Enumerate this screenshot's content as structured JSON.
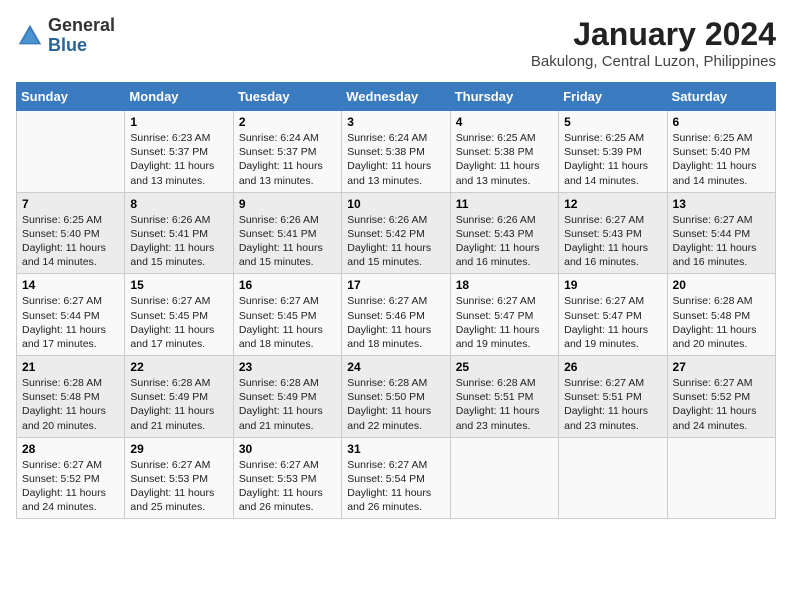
{
  "header": {
    "logo_general": "General",
    "logo_blue": "Blue",
    "month_year": "January 2024",
    "location": "Bakulong, Central Luzon, Philippines"
  },
  "weekdays": [
    "Sunday",
    "Monday",
    "Tuesday",
    "Wednesday",
    "Thursday",
    "Friday",
    "Saturday"
  ],
  "weeks": [
    [
      {
        "day": "",
        "content": ""
      },
      {
        "day": "1",
        "content": "Sunrise: 6:23 AM\nSunset: 5:37 PM\nDaylight: 11 hours\nand 13 minutes."
      },
      {
        "day": "2",
        "content": "Sunrise: 6:24 AM\nSunset: 5:37 PM\nDaylight: 11 hours\nand 13 minutes."
      },
      {
        "day": "3",
        "content": "Sunrise: 6:24 AM\nSunset: 5:38 PM\nDaylight: 11 hours\nand 13 minutes."
      },
      {
        "day": "4",
        "content": "Sunrise: 6:25 AM\nSunset: 5:38 PM\nDaylight: 11 hours\nand 13 minutes."
      },
      {
        "day": "5",
        "content": "Sunrise: 6:25 AM\nSunset: 5:39 PM\nDaylight: 11 hours\nand 14 minutes."
      },
      {
        "day": "6",
        "content": "Sunrise: 6:25 AM\nSunset: 5:40 PM\nDaylight: 11 hours\nand 14 minutes."
      }
    ],
    [
      {
        "day": "7",
        "content": "Sunrise: 6:25 AM\nSunset: 5:40 PM\nDaylight: 11 hours\nand 14 minutes."
      },
      {
        "day": "8",
        "content": "Sunrise: 6:26 AM\nSunset: 5:41 PM\nDaylight: 11 hours\nand 15 minutes."
      },
      {
        "day": "9",
        "content": "Sunrise: 6:26 AM\nSunset: 5:41 PM\nDaylight: 11 hours\nand 15 minutes."
      },
      {
        "day": "10",
        "content": "Sunrise: 6:26 AM\nSunset: 5:42 PM\nDaylight: 11 hours\nand 15 minutes."
      },
      {
        "day": "11",
        "content": "Sunrise: 6:26 AM\nSunset: 5:43 PM\nDaylight: 11 hours\nand 16 minutes."
      },
      {
        "day": "12",
        "content": "Sunrise: 6:27 AM\nSunset: 5:43 PM\nDaylight: 11 hours\nand 16 minutes."
      },
      {
        "day": "13",
        "content": "Sunrise: 6:27 AM\nSunset: 5:44 PM\nDaylight: 11 hours\nand 16 minutes."
      }
    ],
    [
      {
        "day": "14",
        "content": "Sunrise: 6:27 AM\nSunset: 5:44 PM\nDaylight: 11 hours\nand 17 minutes."
      },
      {
        "day": "15",
        "content": "Sunrise: 6:27 AM\nSunset: 5:45 PM\nDaylight: 11 hours\nand 17 minutes."
      },
      {
        "day": "16",
        "content": "Sunrise: 6:27 AM\nSunset: 5:45 PM\nDaylight: 11 hours\nand 18 minutes."
      },
      {
        "day": "17",
        "content": "Sunrise: 6:27 AM\nSunset: 5:46 PM\nDaylight: 11 hours\nand 18 minutes."
      },
      {
        "day": "18",
        "content": "Sunrise: 6:27 AM\nSunset: 5:47 PM\nDaylight: 11 hours\nand 19 minutes."
      },
      {
        "day": "19",
        "content": "Sunrise: 6:27 AM\nSunset: 5:47 PM\nDaylight: 11 hours\nand 19 minutes."
      },
      {
        "day": "20",
        "content": "Sunrise: 6:28 AM\nSunset: 5:48 PM\nDaylight: 11 hours\nand 20 minutes."
      }
    ],
    [
      {
        "day": "21",
        "content": "Sunrise: 6:28 AM\nSunset: 5:48 PM\nDaylight: 11 hours\nand 20 minutes."
      },
      {
        "day": "22",
        "content": "Sunrise: 6:28 AM\nSunset: 5:49 PM\nDaylight: 11 hours\nand 21 minutes."
      },
      {
        "day": "23",
        "content": "Sunrise: 6:28 AM\nSunset: 5:49 PM\nDaylight: 11 hours\nand 21 minutes."
      },
      {
        "day": "24",
        "content": "Sunrise: 6:28 AM\nSunset: 5:50 PM\nDaylight: 11 hours\nand 22 minutes."
      },
      {
        "day": "25",
        "content": "Sunrise: 6:28 AM\nSunset: 5:51 PM\nDaylight: 11 hours\nand 23 minutes."
      },
      {
        "day": "26",
        "content": "Sunrise: 6:27 AM\nSunset: 5:51 PM\nDaylight: 11 hours\nand 23 minutes."
      },
      {
        "day": "27",
        "content": "Sunrise: 6:27 AM\nSunset: 5:52 PM\nDaylight: 11 hours\nand 24 minutes."
      }
    ],
    [
      {
        "day": "28",
        "content": "Sunrise: 6:27 AM\nSunset: 5:52 PM\nDaylight: 11 hours\nand 24 minutes."
      },
      {
        "day": "29",
        "content": "Sunrise: 6:27 AM\nSunset: 5:53 PM\nDaylight: 11 hours\nand 25 minutes."
      },
      {
        "day": "30",
        "content": "Sunrise: 6:27 AM\nSunset: 5:53 PM\nDaylight: 11 hours\nand 26 minutes."
      },
      {
        "day": "31",
        "content": "Sunrise: 6:27 AM\nSunset: 5:54 PM\nDaylight: 11 hours\nand 26 minutes."
      },
      {
        "day": "",
        "content": ""
      },
      {
        "day": "",
        "content": ""
      },
      {
        "day": "",
        "content": ""
      }
    ]
  ]
}
